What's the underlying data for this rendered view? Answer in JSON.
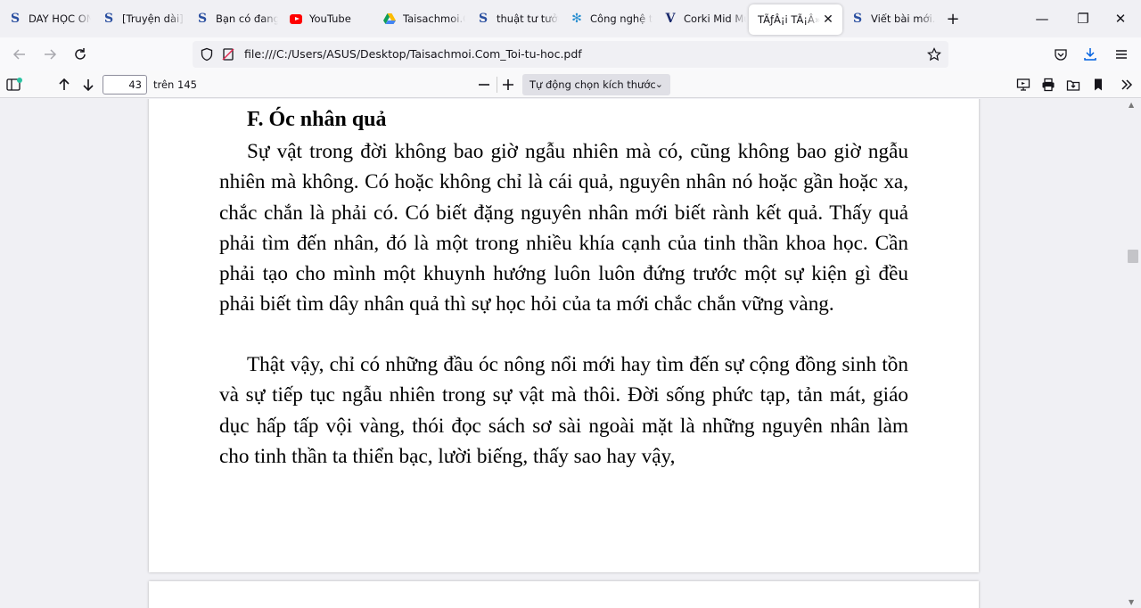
{
  "tabs": [
    {
      "title": "DAY HỌC ONLINE",
      "icon": "s-site-icon",
      "active": false
    },
    {
      "title": "[Truyện dài] Nhật",
      "icon": "s-site-icon",
      "active": false
    },
    {
      "title": "Bạn có đang tìm",
      "icon": "s-site-icon",
      "active": false
    },
    {
      "title": "YouTube",
      "icon": "youtube-icon",
      "active": false
    },
    {
      "title": "Taisachmoi.Com",
      "icon": "google-drive-icon",
      "active": false
    },
    {
      "title": "thuật tư tưởng",
      "icon": "s-site-icon",
      "active": false
    },
    {
      "title": "Công nghệ thông",
      "icon": "gear-site-icon",
      "active": false
    },
    {
      "title": "Corki Mid Mùa",
      "icon": "v-site-icon",
      "active": false
    },
    {
      "title": "TÃƒÂ¡i TÃ¡Â»Â",
      "icon": "none",
      "active": true
    },
    {
      "title": "Viết bài mới...",
      "icon": "s-site-icon",
      "active": false
    }
  ],
  "nav": {
    "url": "file:///C:/Users/ASUS/Desktop/Taisachmoi.Com_Toi-tu-hoc.pdf"
  },
  "pdf_toolbar": {
    "current_page": "43",
    "total_label": "trên 145",
    "zoom_label": "Tự động chọn kích thước"
  },
  "document": {
    "ornament": "***",
    "heading": "F. Óc nhân quả",
    "paragraphs": [
      "Sự vật trong đời không bao giờ ngẫu nhiên mà có, cũng không bao giờ ngẫu nhiên mà không. Có hoặc không chỉ là cái quả, nguyên nhân nó hoặc gần hoặc xa, chắc chắn là phải có. Có biết đặng nguyên nhân mới biết rành kết quả. Thấy quả phải tìm đến nhân, đó là một trong nhiều khía cạnh của tinh thần khoa học. Cần phải tạo cho mình một khuynh hướng luôn luôn đứng trước một sự kiện gì đều phải biết tìm dây nhân quả thì sự học hỏi của ta mới chắc chắn vững vàng.",
      "Thật vậy, chỉ có những đầu óc nông nổi mới hay tìm đến sự cộng đồng sinh tồn và sự tiếp tục ngẫu nhiên trong sự vật mà thôi. Đời sống phức tạp, tản mát, giáo dục hấp tấp vội vàng, thói đọc sách sơ sài ngoài mặt là những nguyên nhân làm cho tinh thần ta thiển bạc, lười biếng, thấy sao hay vậy,"
    ]
  }
}
